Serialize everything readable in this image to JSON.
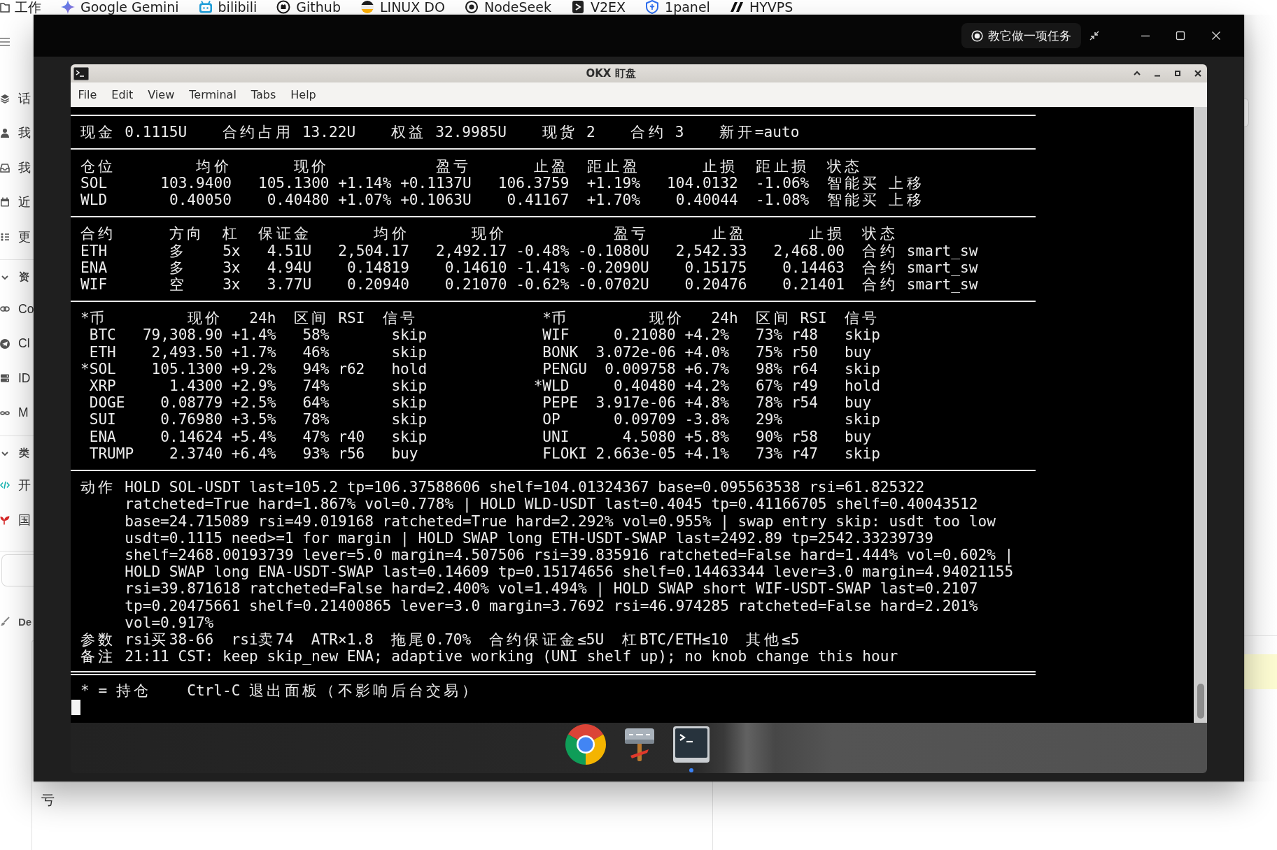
{
  "bookmarks": [
    {
      "kind": "folder",
      "label": "工作"
    },
    {
      "kind": "sparkle",
      "label": "Google Gemini"
    },
    {
      "kind": "tv",
      "label": "bilibili"
    },
    {
      "kind": "cat",
      "label": "Github"
    },
    {
      "kind": "stripes",
      "label": "LINUX DO"
    },
    {
      "kind": "ring",
      "label": "NodeSeek"
    },
    {
      "kind": "square",
      "label": "V2EX"
    },
    {
      "kind": "shield",
      "label": "1panel"
    },
    {
      "kind": "angular",
      "label": "HYVPS"
    }
  ],
  "sidebar": {
    "groups": [
      {
        "items": [
          {
            "kind": "layers",
            "label": "话"
          },
          {
            "kind": "person",
            "label": "我"
          },
          {
            "kind": "inbox",
            "label": "我"
          },
          {
            "kind": "calendar",
            "label": "近"
          },
          {
            "kind": "dots",
            "label": "更"
          }
        ]
      },
      {
        "title": "资",
        "items": [
          {
            "kind": "link",
            "label": "Co"
          },
          {
            "kind": "plane",
            "label": "Cl"
          },
          {
            "kind": "server",
            "label": "ID"
          },
          {
            "kind": "infinity",
            "label": "M"
          }
        ]
      },
      {
        "title": "类",
        "items": [
          {
            "kind": "code",
            "label": "开"
          },
          {
            "kind": "sprout",
            "label": "国"
          }
        ]
      },
      {
        "items": [
          {
            "kind": "brush",
            "label": "De"
          }
        ]
      }
    ]
  },
  "lower_panel": {
    "text": "亏"
  },
  "viewer": {
    "task_button": "教它做一项任务"
  },
  "terminal": {
    "title": "OKX 盯盘",
    "menu": [
      "File",
      "Edit",
      "View",
      "Terminal",
      "Tabs",
      "Help"
    ],
    "summary": [
      "现金 0.1115U",
      "合约占用 13.22U",
      "权益 32.9985U",
      "现货 2",
      "合约 3",
      "新开=auto"
    ],
    "positions": {
      "columns": {
        "position": "仓位",
        "avg_price": "均价",
        "price": "现价",
        "pnl": "盈亏",
        "take_profit": "止盈",
        "to_take_profit": "距止盈",
        "stop_loss": "止损",
        "to_stop_loss": "距止损",
        "status": "状态"
      },
      "rows": [
        {
          "position": "SOL",
          "avg_price": "103.9400",
          "price": "105.1300",
          "column_4": "+1.14%",
          "pnl": "+0.1137U",
          "take_profit": "106.3759",
          "to_take_profit": "+1.19%",
          "stop_loss": "104.0132",
          "to_stop_loss": "-1.06%",
          "status": "智能买 上移"
        },
        {
          "position": "WLD",
          "avg_price": "0.40050",
          "price": "0.40480",
          "column_4": "+1.07%",
          "pnl": "+0.1063U",
          "take_profit": "0.41167",
          "to_take_profit": "+1.70%",
          "stop_loss": "0.40044",
          "to_stop_loss": "-1.08%",
          "status": "智能买 上移"
        }
      ]
    },
    "contracts": {
      "columns": {
        "contract": "合约",
        "side": "方向",
        "leverage": "杠",
        "margin": "保证金",
        "avg_price": "均价",
        "price": "现价",
        "pnl": "盈亏",
        "take_profit": "止盈",
        "stop_loss": "止损",
        "status": "状态"
      },
      "rows": [
        {
          "contract": "ETH",
          "side": "多",
          "leverage": "5x",
          "margin": "4.51U",
          "avg_price": "2,504.17",
          "price": "2,492.17",
          "column_7": "-0.48%",
          "pnl": "-0.1080U",
          "take_profit": "2,542.33",
          "stop_loss": "2,468.00",
          "status": "合约 smart_sw"
        },
        {
          "contract": "ENA",
          "side": "多",
          "leverage": "3x",
          "margin": "4.94U",
          "avg_price": "0.14819",
          "price": "0.14610",
          "column_7": "-1.41%",
          "pnl": "-0.2090U",
          "take_profit": "0.15175",
          "stop_loss": "0.14463",
          "status": "合约 smart_sw"
        },
        {
          "contract": "WIF",
          "side": "空",
          "leverage": "3x",
          "margin": "3.77U",
          "avg_price": "0.20940",
          "price": "0.21070",
          "column_7": "-0.62%",
          "pnl": "-0.0702U",
          "take_profit": "0.20476",
          "stop_loss": "0.21401",
          "status": "合约 smart_sw"
        }
      ]
    },
    "watchlist": [
      {
        "columns": {
          "coin": "*币",
          "price": "现价",
          "change_24h": "24h",
          "range": "区间",
          "rsi": "RSI",
          "signal": "信号"
        },
        "rows": [
          {
            "coin": "BTC",
            "price": "79,308.90",
            "change_24h": "+1.4%",
            "range": "58%",
            "signal": "skip"
          },
          {
            "coin": "ETH",
            "price": "2,493.50",
            "change_24h": "+1.7%",
            "range": "46%",
            "signal": "skip"
          },
          {
            "mark": "*",
            "coin": "SOL",
            "price": "105.1300",
            "change_24h": "+9.2%",
            "range": "94%",
            "rsi": "r62",
            "signal": "hold"
          },
          {
            "coin": "XRP",
            "price": "1.4300",
            "change_24h": "+2.9%",
            "range": "74%",
            "signal": "skip"
          },
          {
            "coin": "DOGE",
            "price": "0.08779",
            "change_24h": "+2.5%",
            "range": "64%",
            "signal": "skip"
          },
          {
            "coin": "SUI",
            "price": "0.76980",
            "change_24h": "+3.5%",
            "range": "78%",
            "signal": "skip"
          },
          {
            "coin": "ENA",
            "price": "0.14624",
            "change_24h": "+5.4%",
            "range": "47%",
            "rsi": "r40",
            "signal": "skip"
          },
          {
            "coin": "TRUMP",
            "price": "2.3740",
            "change_24h": "+6.4%",
            "range": "93%",
            "rsi": "r56",
            "signal": "buy"
          }
        ]
      },
      {
        "columns": {
          "coin": "*币",
          "price": "现价",
          "change_24h": "24h",
          "range": "区间",
          "rsi": "RSI",
          "signal": "信号"
        },
        "rows": [
          {
            "coin": "WIF",
            "price": "0.21080",
            "change_24h": "+4.2%",
            "range": "73%",
            "rsi": "r48",
            "signal": "skip"
          },
          {
            "coin": "BONK",
            "price": "3.072e-06",
            "change_24h": "+4.0%",
            "range": "75%",
            "rsi": "r50",
            "signal": "buy"
          },
          {
            "coin": "PENGU",
            "price": "0.009758",
            "change_24h": "+6.7%",
            "range": "98%",
            "rsi": "r64",
            "signal": "skip"
          },
          {
            "mark": "*",
            "coin": "WLD",
            "price": "0.40480",
            "change_24h": "+4.2%",
            "range": "67%",
            "rsi": "r49",
            "signal": "hold"
          },
          {
            "coin": "PEPE",
            "price": "3.917e-06",
            "change_24h": "+4.8%",
            "range": "78%",
            "rsi": "r54",
            "signal": "buy"
          },
          {
            "coin": "OP",
            "price": "0.09709",
            "change_24h": "-3.8%",
            "range": "29%",
            "signal": "skip"
          },
          {
            "coin": "UNI",
            "price": "4.5080",
            "change_24h": "+5.8%",
            "range": "90%",
            "rsi": "r58",
            "signal": "buy"
          },
          {
            "coin": "FLOKI",
            "price": "2.663e-05",
            "change_24h": "+4.1%",
            "range": "73%",
            "rsi": "r47",
            "signal": "skip"
          }
        ]
      }
    ],
    "log": [
      {
        "kind": "text",
        "label": "动作",
        "text": "HOLD SOL-USDT last=105.2 tp=106.37588606 shelf=104.01324367 base=0.095563538 rsi=61.825322 ratcheted=True hard=1.867% vol=0.778% | HOLD WLD-USDT last=0.4045 tp=0.41166705 shelf=0.40043512 base=24.715089 rsi=49.019168 ratcheted=True hard=2.292% vol=0.955% | swap entry skip: usdt too low usdt=0.1115 need>=1 for margin | HOLD SWAP long ETH-USDT-SWAP last=2492.89 tp=2542.33239739 shelf=2468.00193739 lever=5.0 margin=4.507506 rsi=39.835916 ratcheted=False hard=1.444% vol=0.602% | HOLD SWAP long ENA-USDT-SWAP last=0.14609 tp=0.15174656 shelf=0.14463344 lever=3.0 margin=4.94021155 rsi=39.871618 ratcheted=False hard=2.400% vol=1.494% | HOLD SWAP short WIF-USDT-SWAP last=0.2107 tp=0.20475661 shelf=0.21400865 lever=3.0 margin=3.7692 rsi=46.974285 ratcheted=False hard=2.201% vol=0.917%"
      },
      {
        "kind": "list",
        "label": "参数",
        "items": [
          "rsi买38-66",
          "rsi卖74",
          "ATR×1.8",
          "拖尾0.70%",
          "合约保证金≤5U",
          "杠BTC/ETH≤10",
          "其他≤5"
        ]
      },
      {
        "kind": "text",
        "label": "备注",
        "text": "21:11 CST: keep skip_new ENA; adaptive working (UNI shelf up); no knob change this hour"
      }
    ],
    "footer": [
      "* = 持仓",
      "Ctrl-C 退出面板（不影响后台交易）"
    ]
  },
  "dock": [
    {
      "kind": "browser",
      "running": false
    },
    {
      "kind": "signpost",
      "running": false
    },
    {
      "kind": "terminal",
      "running": true
    }
  ]
}
